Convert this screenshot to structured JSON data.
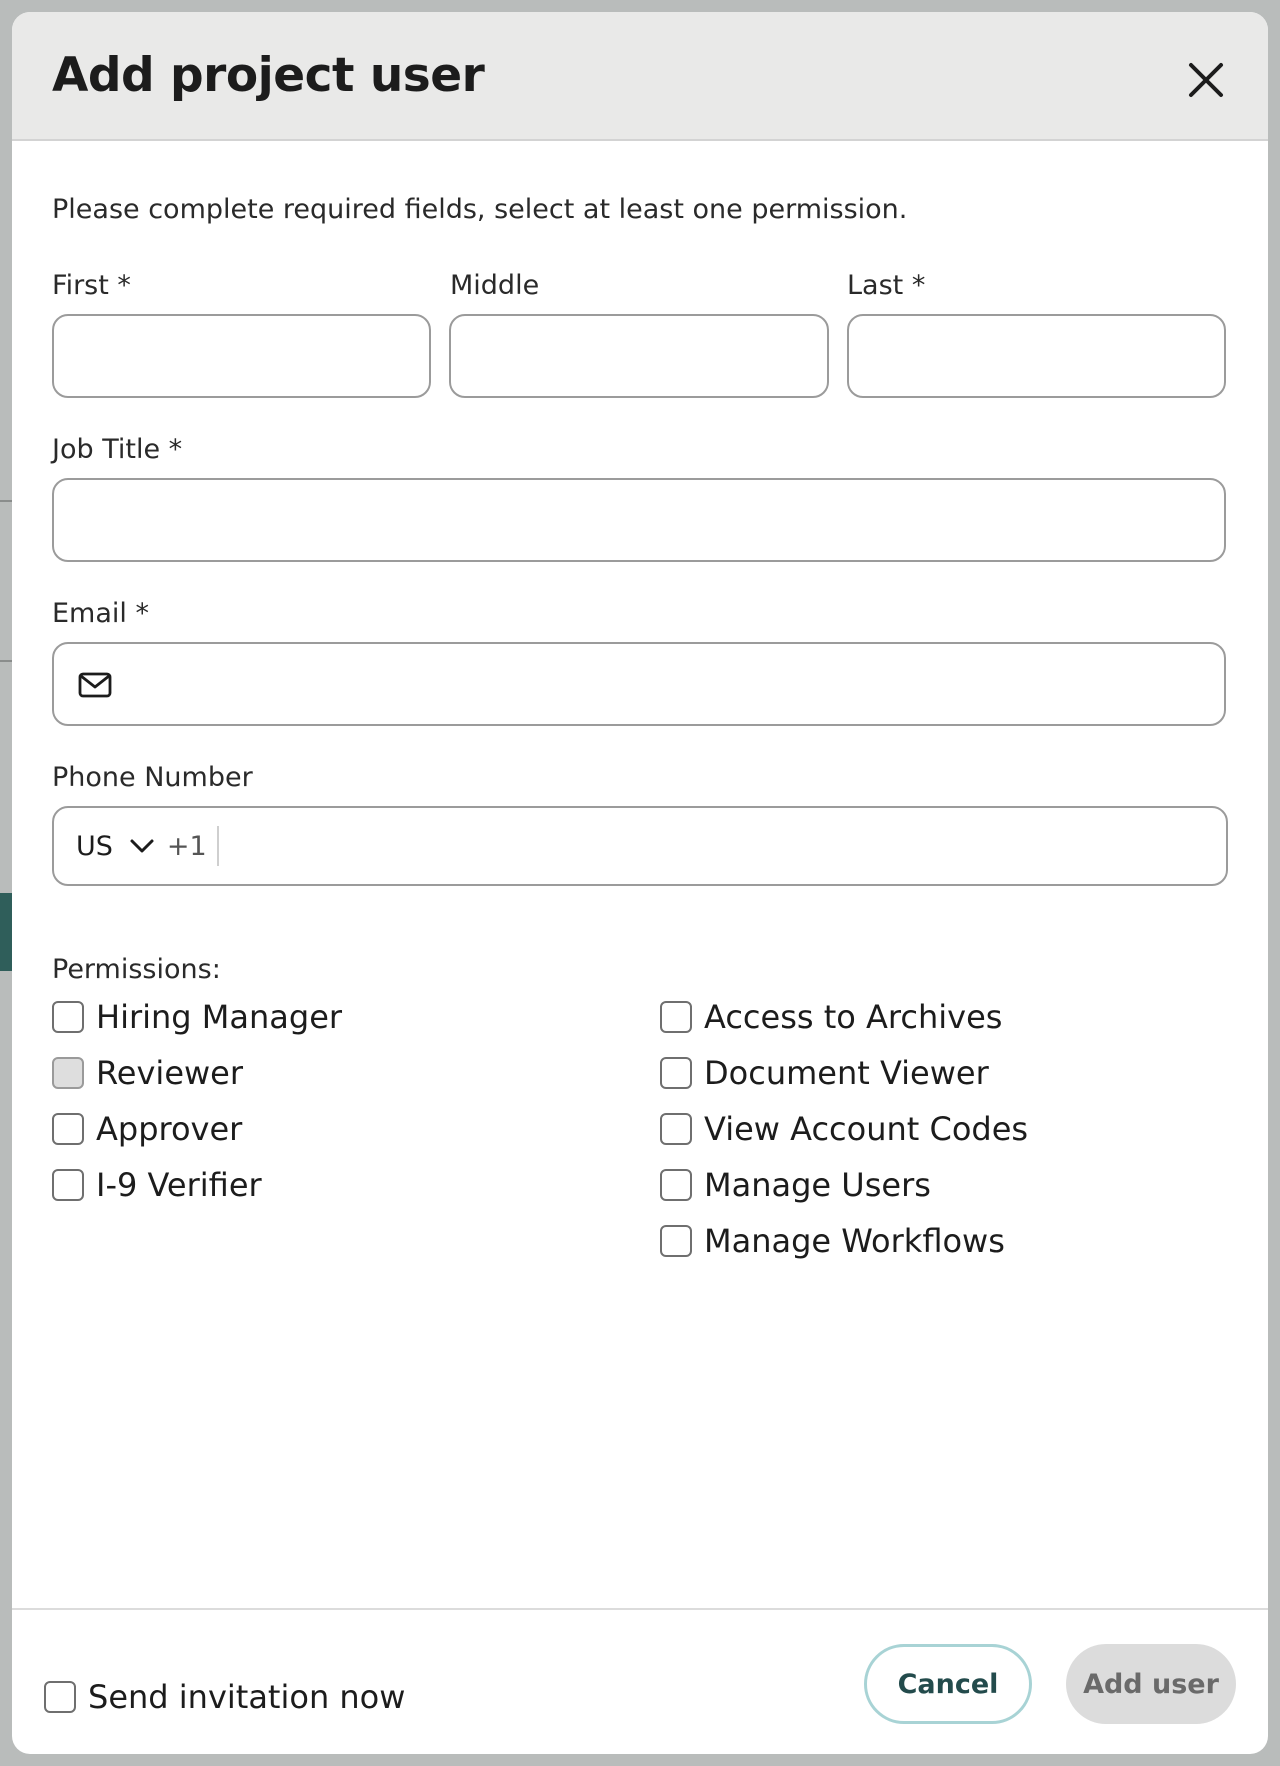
{
  "dialog": {
    "title": "Add project user",
    "intro": "Please complete required fields, select at least one permission."
  },
  "fields": {
    "first_label": "First *",
    "first_value": "",
    "middle_label": "Middle",
    "middle_value": "",
    "last_label": "Last *",
    "last_value": "",
    "job_title_label": "Job Title *",
    "job_title_value": "",
    "email_label": "Email *",
    "email_value": "",
    "phone_label": "Phone Number",
    "phone_country": "US",
    "phone_dial_code": "+1",
    "phone_value": ""
  },
  "permissions": {
    "title": "Permissions:",
    "left": [
      {
        "label": "Hiring Manager",
        "checked": false,
        "disabled": false
      },
      {
        "label": "Reviewer",
        "checked": false,
        "disabled": true
      },
      {
        "label": "Approver",
        "checked": false,
        "disabled": false
      },
      {
        "label": "I-9 Verifier",
        "checked": false,
        "disabled": false
      }
    ],
    "right": [
      {
        "label": "Access to Archives",
        "checked": false,
        "disabled": false
      },
      {
        "label": "Document Viewer",
        "checked": false,
        "disabled": false
      },
      {
        "label": "View Account Codes",
        "checked": false,
        "disabled": false
      },
      {
        "label": "Manage Users",
        "checked": false,
        "disabled": false
      },
      {
        "label": "Manage Workflows",
        "checked": false,
        "disabled": false
      }
    ]
  },
  "footer": {
    "send_invitation_label": "Send invitation now",
    "send_invitation_checked": false,
    "cancel_label": "Cancel",
    "add_user_label": "Add user"
  },
  "icons": {
    "close": "close-icon",
    "email": "mail-icon",
    "country_dropdown": "chevron-down-icon"
  },
  "colors": {
    "header_bg": "#e9e9e8",
    "cancel_border": "#a8d3d5",
    "cancel_text": "#234b4c",
    "add_user_bg": "#dcdcdc",
    "add_user_text": "#6a6a6a"
  }
}
